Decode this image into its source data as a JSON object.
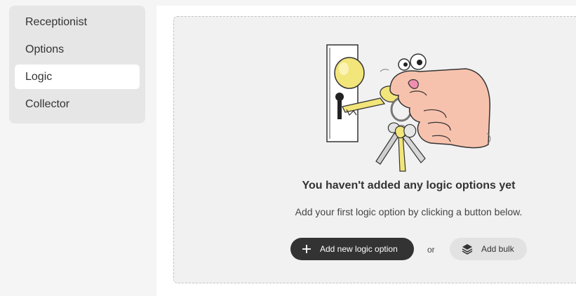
{
  "sidebar": {
    "items": [
      {
        "label": "Receptionist"
      },
      {
        "label": "Options"
      },
      {
        "label": "Logic",
        "active": true
      },
      {
        "label": "Collector"
      }
    ]
  },
  "empty_state": {
    "title": "You haven't added any logic options yet",
    "description": "Add your first logic option by clicking a button below.",
    "primary_button": {
      "label": "Add new logic option",
      "icon": "plus-icon"
    },
    "separator": "or",
    "secondary_button": {
      "label": "Add bulk",
      "icon": "layers-icon"
    },
    "illustration": "hand-with-keys-in-door-lock"
  },
  "colors": {
    "page_bg": "#f5f5f5",
    "sidebar_bg": "#e6e6e6",
    "active_item_bg": "#ffffff",
    "empty_bg": "#f1f1f1",
    "primary_button_bg": "#333333",
    "secondary_button_bg": "#e2e2e2",
    "key_yellow": "#f2e57a",
    "hand_skin": "#f7c2ad"
  }
}
